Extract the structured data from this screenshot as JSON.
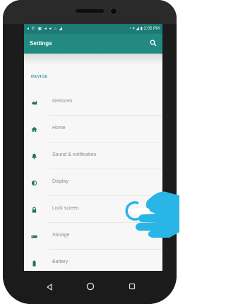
{
  "status_bar": {
    "left_icons": "◂ ✆ ▣ ◂ ◂ ⌂ ◢",
    "right_text": "◔ ▾ ◢ ▮ 2:05 PM"
  },
  "app_bar": {
    "title": "Settings",
    "search_icon": "search-icon"
  },
  "section": {
    "header": "DEVICE"
  },
  "items": [
    {
      "label": "Gestures",
      "icon": "gesture-icon"
    },
    {
      "label": "Home",
      "icon": "home-icon"
    },
    {
      "label": "Sound & notification",
      "icon": "bell-icon"
    },
    {
      "label": "Display",
      "icon": "brightness-icon"
    },
    {
      "label": "Lock screen",
      "icon": "lock-icon"
    },
    {
      "label": "Storage",
      "icon": "storage-icon"
    },
    {
      "label": "Battery",
      "icon": "battery-icon"
    }
  ],
  "colors": {
    "accent": "#238a82",
    "status_bar": "#1d7a74",
    "item_text": "#8a8a8a",
    "hand": "#29b6e6"
  },
  "nav_bar": {
    "back": "back-icon",
    "home": "home-circle-icon",
    "recent": "recent-apps-icon"
  }
}
